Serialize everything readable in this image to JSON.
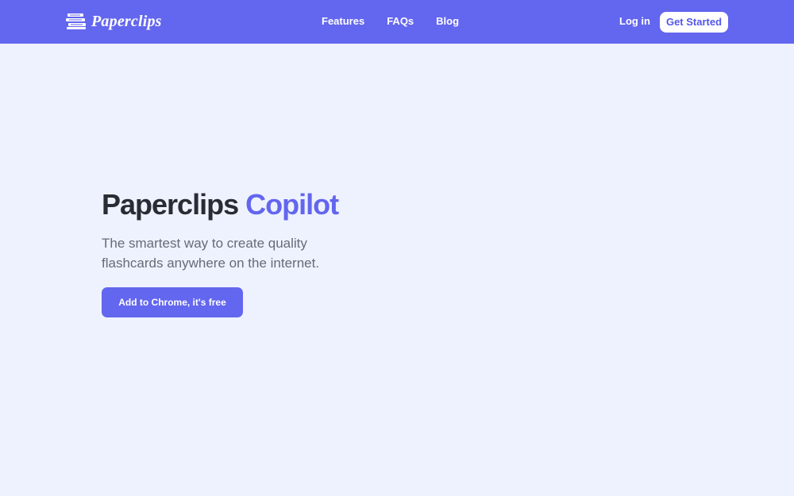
{
  "brand": {
    "name": "Paperclips",
    "icon": "paperclips-logo-icon"
  },
  "nav": {
    "links": [
      {
        "label": "Features"
      },
      {
        "label": "FAQs"
      },
      {
        "label": "Blog"
      }
    ],
    "login_label": "Log in",
    "cta_label": "Get Started"
  },
  "hero": {
    "title_main": "Paperclips",
    "title_accent": "Copilot",
    "subtitle": "The smartest way to create quality flashcards anywhere on the internet.",
    "button_label": "Add to Chrome, it's free"
  },
  "colors": {
    "brand": "#6366ee",
    "background": "#eef2fe",
    "heading": "#2a2c33",
    "body_text": "#666b78"
  }
}
